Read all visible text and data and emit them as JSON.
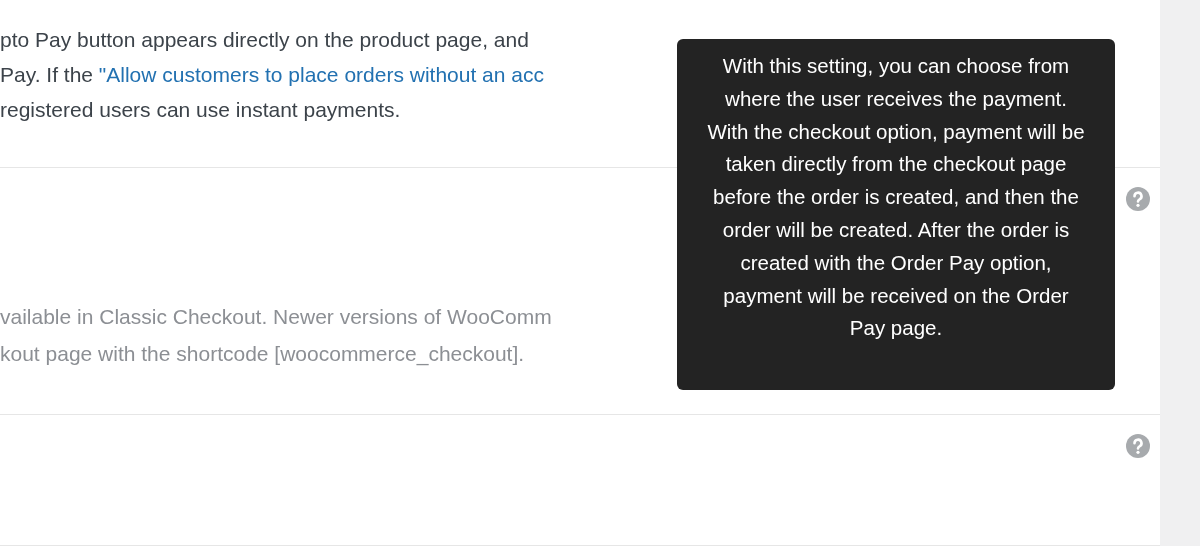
{
  "intro": {
    "lines": [
      {
        "text": "pto Pay button appears directly on the product page, and"
      },
      {
        "text": "Pay. If the ",
        "link": "\"Allow customers to place orders without an acc"
      },
      {
        "text": "registered users can use instant payments."
      }
    ]
  },
  "settings": [
    {
      "help_icon": true,
      "description": [
        "vailable in Classic Checkout. Newer versions of WooComm",
        "kout page with the shortcode [woocommerce_checkout]."
      ]
    },
    {
      "help_icon": true
    }
  ],
  "tooltip": {
    "text": "With this setting, you can choose from where the user receives the payment. With the checkout option, payment will be taken directly from the checkout page before the order is created, and then the order will be created. After the order is created with the Order Pay option, payment will be received on the Order Pay page."
  }
}
